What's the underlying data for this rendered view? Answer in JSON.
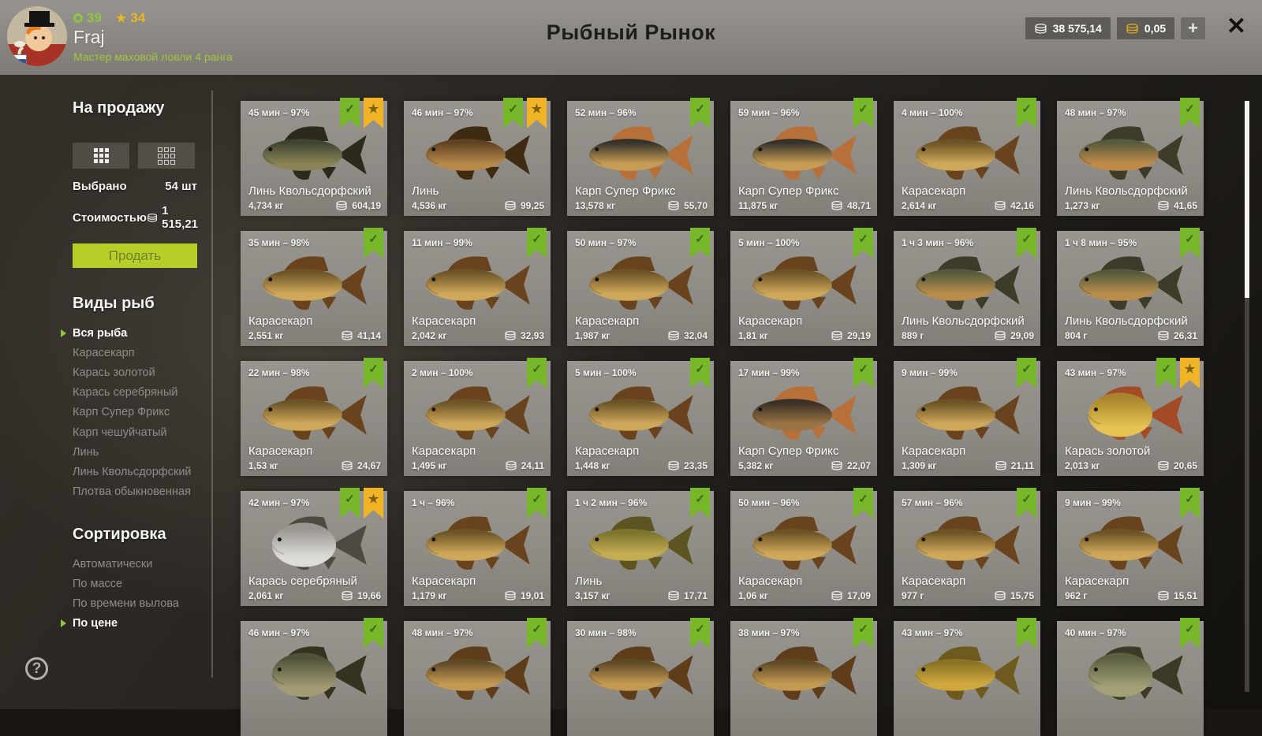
{
  "header": {
    "title": "Рыбный Рынок",
    "player": {
      "name": "Fraj",
      "level_badge": "39",
      "stars_badge": "34",
      "rank": "Мастер маховой ловли 4 ранга"
    },
    "silver_balance": "38 575,14",
    "gold_balance": "0,05",
    "add_button": "+",
    "close_button": "✕"
  },
  "sidebar": {
    "sale_section": {
      "title": "На продажу",
      "selected_label": "Выбрано",
      "selected_value": "54 шт",
      "cost_label": "Стоимостью",
      "cost_value": "1 515,21",
      "sell_button": "Продать"
    },
    "species_section": {
      "title": "Виды рыб",
      "items": [
        {
          "label": "Вся рыба",
          "active": true
        },
        {
          "label": "Карасекарп",
          "active": false
        },
        {
          "label": "Карась золотой",
          "active": false
        },
        {
          "label": "Карась серебряный",
          "active": false
        },
        {
          "label": "Карп Супер Фрикс",
          "active": false
        },
        {
          "label": "Карп чешуйчатый",
          "active": false
        },
        {
          "label": "Линь",
          "active": false
        },
        {
          "label": "Линь Квольсдорфский",
          "active": false
        },
        {
          "label": "Плотва обыкновенная",
          "active": false
        }
      ]
    },
    "sort_section": {
      "title": "Сортировка",
      "items": [
        {
          "label": "Автоматически",
          "active": false
        },
        {
          "label": "По массе",
          "active": false
        },
        {
          "label": "По времени вылова",
          "active": false
        },
        {
          "label": "По цене",
          "active": true
        }
      ]
    },
    "help_icon": "?"
  },
  "colors": {
    "accent_green": "#8dc63f",
    "ribbon_green": "#77b82b",
    "ribbon_yellow": "#f0b426",
    "sell_button_bg": "#b6ce27"
  },
  "market": {
    "cards": [
      {
        "time": "45 мин – 97%",
        "name": "Линь Квольсдорфский",
        "weight": "4,734 кг",
        "price": "604,19",
        "flags": [
          "check",
          "star"
        ],
        "fish": {
          "shape": "long",
          "back": "#3f4430",
          "belly": "#8a8456",
          "fin": "#2c2a1c"
        }
      },
      {
        "time": "46 мин – 97%",
        "name": "Линь",
        "weight": "4,536 кг",
        "price": "99,25",
        "flags": [
          "check",
          "star"
        ],
        "fish": {
          "shape": "long",
          "back": "#5f4222",
          "belly": "#b8894a",
          "fin": "#3f2a12"
        }
      },
      {
        "time": "52 мин – 96%",
        "name": "Карп Супер Фрикс",
        "weight": "13,578 кг",
        "price": "55,70",
        "flags": [
          "check"
        ],
        "fish": {
          "shape": "long",
          "back": "#35322c",
          "belly": "#c79d55",
          "fin": "#b7703a"
        }
      },
      {
        "time": "59 мин – 96%",
        "name": "Карп Супер Фрикс",
        "weight": "11,875 кг",
        "price": "48,71",
        "flags": [
          "check"
        ],
        "fish": {
          "shape": "long",
          "back": "#35322c",
          "belly": "#c79d55",
          "fin": "#b7703a"
        }
      },
      {
        "time": "4 мин – 100%",
        "name": "Карасекарп",
        "weight": "2,614 кг",
        "price": "42,16",
        "flags": [
          "check"
        ],
        "fish": {
          "shape": "long",
          "back": "#6d5426",
          "belly": "#cfa85a",
          "fin": "#69431d"
        }
      },
      {
        "time": "48 мин – 97%",
        "name": "Линь Квольсдорфский",
        "weight": "1,273 кг",
        "price": "41,65",
        "flags": [
          "check"
        ],
        "fish": {
          "shape": "long",
          "back": "#565b3c",
          "belly": "#c08b49",
          "fin": "#3e3c28"
        }
      },
      {
        "time": "35 мин – 98%",
        "name": "Карасекарп",
        "weight": "2,551 кг",
        "price": "41,14",
        "flags": [
          "check"
        ],
        "fish": {
          "shape": "long",
          "back": "#6d5426",
          "belly": "#cfa85a",
          "fin": "#69431d"
        }
      },
      {
        "time": "11 мин – 99%",
        "name": "Карасекарп",
        "weight": "2,042 кг",
        "price": "32,93",
        "flags": [
          "check"
        ],
        "fish": {
          "shape": "long",
          "back": "#6d5426",
          "belly": "#cfa85a",
          "fin": "#69431d"
        }
      },
      {
        "time": "50 мин – 97%",
        "name": "Карасекарп",
        "weight": "1,987 кг",
        "price": "32,04",
        "flags": [
          "check"
        ],
        "fish": {
          "shape": "long",
          "back": "#6d5426",
          "belly": "#cfa85a",
          "fin": "#69431d"
        }
      },
      {
        "time": "5 мин – 100%",
        "name": "Карасекарп",
        "weight": "1,81 кг",
        "price": "29,19",
        "flags": [
          "check"
        ],
        "fish": {
          "shape": "long",
          "back": "#6d5426",
          "belly": "#cfa85a",
          "fin": "#69431d"
        }
      },
      {
        "time": "1 ч 3 мин – 96%",
        "name": "Линь Квольсдорфский",
        "weight": "889 г",
        "price": "29,09",
        "flags": [
          "check"
        ],
        "fish": {
          "shape": "long",
          "back": "#555a3b",
          "belly": "#b98e4d",
          "fin": "#3e3c28"
        }
      },
      {
        "time": "1 ч 8 мин – 95%",
        "name": "Линь Квольсдорфский",
        "weight": "804 г",
        "price": "26,31",
        "flags": [
          "check"
        ],
        "fish": {
          "shape": "long",
          "back": "#555a3b",
          "belly": "#b98e4d",
          "fin": "#3e3c28"
        }
      },
      {
        "time": "22 мин – 98%",
        "name": "Карасекарп",
        "weight": "1,53 кг",
        "price": "24,67",
        "flags": [
          "check"
        ],
        "fish": {
          "shape": "long",
          "back": "#6d5426",
          "belly": "#cfa85a",
          "fin": "#69431d"
        }
      },
      {
        "time": "2 мин – 100%",
        "name": "Карасекарп",
        "weight": "1,495 кг",
        "price": "24,11",
        "flags": [
          "check"
        ],
        "fish": {
          "shape": "long",
          "back": "#6d5426",
          "belly": "#cfa85a",
          "fin": "#69431d"
        }
      },
      {
        "time": "5 мин – 100%",
        "name": "Карасекарп",
        "weight": "1,448 кг",
        "price": "23,35",
        "flags": [
          "check"
        ],
        "fish": {
          "shape": "long",
          "back": "#6d5426",
          "belly": "#cfa85a",
          "fin": "#69431d"
        }
      },
      {
        "time": "17 мин – 99%",
        "name": "Карп Супер Фрикс",
        "weight": "5,382 кг",
        "price": "22,07",
        "flags": [
          "check"
        ],
        "fish": {
          "shape": "long",
          "back": "#3a3026",
          "belly": "#9a7444",
          "fin": "#b7703a"
        }
      },
      {
        "time": "9 мин – 99%",
        "name": "Карасекарп",
        "weight": "1,309 кг",
        "price": "21,11",
        "flags": [
          "check"
        ],
        "fish": {
          "shape": "long",
          "back": "#6d5426",
          "belly": "#cfa85a",
          "fin": "#69431d"
        }
      },
      {
        "time": "43 мин – 97%",
        "name": "Карась золотой",
        "weight": "2,013 кг",
        "price": "20,65",
        "flags": [
          "check",
          "star"
        ],
        "fish": {
          "shape": "round",
          "back": "#a8852c",
          "belly": "#e7c353",
          "fin": "#a34a26"
        }
      },
      {
        "time": "42 мин – 97%",
        "name": "Карась серебряный",
        "weight": "2,061 кг",
        "price": "19,66",
        "flags": [
          "check",
          "star"
        ],
        "fish": {
          "shape": "round",
          "back": "#97958e",
          "belly": "#dddcd6",
          "fin": "#4e4a42"
        }
      },
      {
        "time": "1 ч – 96%",
        "name": "Карасекарп",
        "weight": "1,179 кг",
        "price": "19,01",
        "flags": [
          "check"
        ],
        "fish": {
          "shape": "long",
          "back": "#6d5426",
          "belly": "#cfa85a",
          "fin": "#69431d"
        }
      },
      {
        "time": "1 ч 2 мин – 96%",
        "name": "Линь",
        "weight": "3,157 кг",
        "price": "17,71",
        "flags": [
          "check"
        ],
        "fish": {
          "shape": "long",
          "back": "#7d7430",
          "belly": "#c4ad50",
          "fin": "#5c5522"
        }
      },
      {
        "time": "50 мин – 96%",
        "name": "Карасекарп",
        "weight": "1,06 кг",
        "price": "17,09",
        "flags": [
          "check"
        ],
        "fish": {
          "shape": "long",
          "back": "#6d5426",
          "belly": "#cfa85a",
          "fin": "#69431d"
        }
      },
      {
        "time": "57 мин – 96%",
        "name": "Карасекарп",
        "weight": "977 г",
        "price": "15,75",
        "flags": [
          "check"
        ],
        "fish": {
          "shape": "long",
          "back": "#6d5426",
          "belly": "#cfa85a",
          "fin": "#69431d"
        }
      },
      {
        "time": "9 мин – 99%",
        "name": "Карасекарп",
        "weight": "962 г",
        "price": "15,51",
        "flags": [
          "check"
        ],
        "fish": {
          "shape": "long",
          "back": "#6d5426",
          "belly": "#cfa85a",
          "fin": "#69431d"
        }
      },
      {
        "time": "46 мин – 97%",
        "name": "",
        "weight": "",
        "price": "",
        "flags": [
          "check"
        ],
        "fish": {
          "shape": "round",
          "back": "#4f5138",
          "belly": "#a29c74",
          "fin": "#35321f"
        }
      },
      {
        "time": "48 мин – 97%",
        "name": "",
        "weight": "",
        "price": "",
        "flags": [
          "check"
        ],
        "fish": {
          "shape": "long",
          "back": "#5f4a26",
          "belly": "#c39a52",
          "fin": "#5f3c1a"
        }
      },
      {
        "time": "30 мин – 98%",
        "name": "",
        "weight": "",
        "price": "",
        "flags": [
          "check"
        ],
        "fish": {
          "shape": "long",
          "back": "#5f4a26",
          "belly": "#c39a52",
          "fin": "#5f3c1a"
        }
      },
      {
        "time": "38 мин – 97%",
        "name": "",
        "weight": "",
        "price": "",
        "flags": [
          "check"
        ],
        "fish": {
          "shape": "long",
          "back": "#5f4a26",
          "belly": "#c39a52",
          "fin": "#5f3c1a"
        }
      },
      {
        "time": "43 мин – 97%",
        "name": "",
        "weight": "",
        "price": "",
        "flags": [
          "check"
        ],
        "fish": {
          "shape": "long",
          "back": "#8a7326",
          "belly": "#cfa83e",
          "fin": "#6e5a1e"
        }
      },
      {
        "time": "40 мин – 97%",
        "name": "",
        "weight": "",
        "price": "",
        "flags": [
          "check"
        ],
        "fish": {
          "shape": "round",
          "back": "#5c6040",
          "belly": "#a3a178",
          "fin": "#3c3a26"
        }
      }
    ]
  }
}
